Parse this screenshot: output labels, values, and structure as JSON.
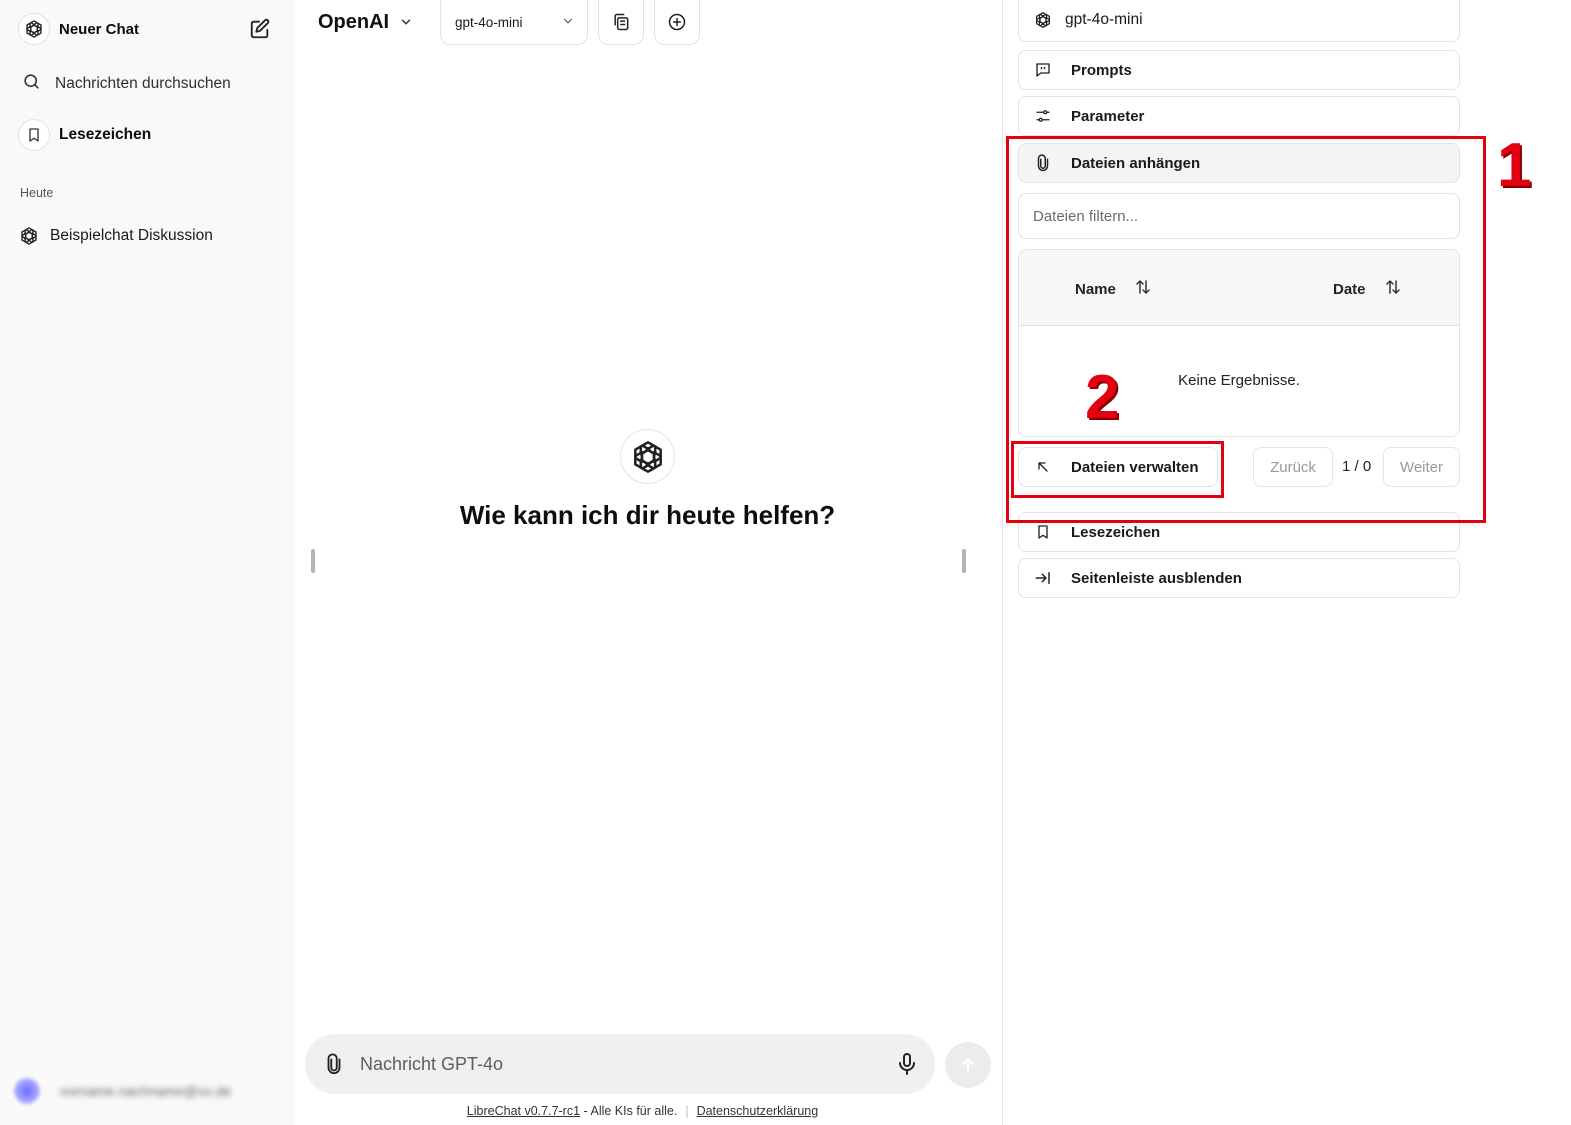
{
  "sidebar": {
    "new_chat_label": "Neuer Chat",
    "search_label": "Nachrichten durchsuchen",
    "bookmarks_label": "Lesezeichen",
    "section_today": "Heute",
    "chats": [
      {
        "title": "Beispielchat Diskussion"
      }
    ],
    "user": {
      "email": "vorname.nachname@xx.de"
    }
  },
  "header": {
    "provider": "OpenAI",
    "model": "gpt-4o-mini"
  },
  "main": {
    "welcome": "Wie kann ich dir heute helfen?",
    "composer": {
      "placeholder": "Nachricht GPT-4o"
    },
    "footer": {
      "version_link": "LibreChat v0.7.7-rc1",
      "tagline": " - Alle KIs für alle.",
      "privacy_link": "Datenschutzerklärung"
    }
  },
  "right_panel": {
    "model": "gpt-4o-mini",
    "prompts_label": "Prompts",
    "parameters_label": "Parameter",
    "attach_files_label": "Dateien anhängen",
    "filter_placeholder": "Dateien filtern...",
    "table": {
      "columns": [
        "Name",
        "Date"
      ],
      "empty_text": "Keine Ergebnisse."
    },
    "manage_files_label": "Dateien verwalten",
    "pager": {
      "prev": "Zurück",
      "count": "1 / 0",
      "next": "Weiter"
    },
    "bookmarks_label": "Lesezeichen",
    "hide_sidebar_label": "Seitenleiste ausblenden"
  },
  "annotations": {
    "label_1": "1",
    "label_2": "2",
    "color": "#e3000f"
  },
  "icons": [
    "openai-logo-icon",
    "edit-icon",
    "search-icon",
    "bookmark-icon",
    "chevron-down-icon",
    "copy-icon",
    "plus-circle-icon",
    "paperclip-icon",
    "microphone-icon",
    "arrow-up-icon",
    "prompts-icon",
    "sliders-icon",
    "sort-icon",
    "arrow-up-left-icon",
    "arrow-right-bar-icon"
  ]
}
